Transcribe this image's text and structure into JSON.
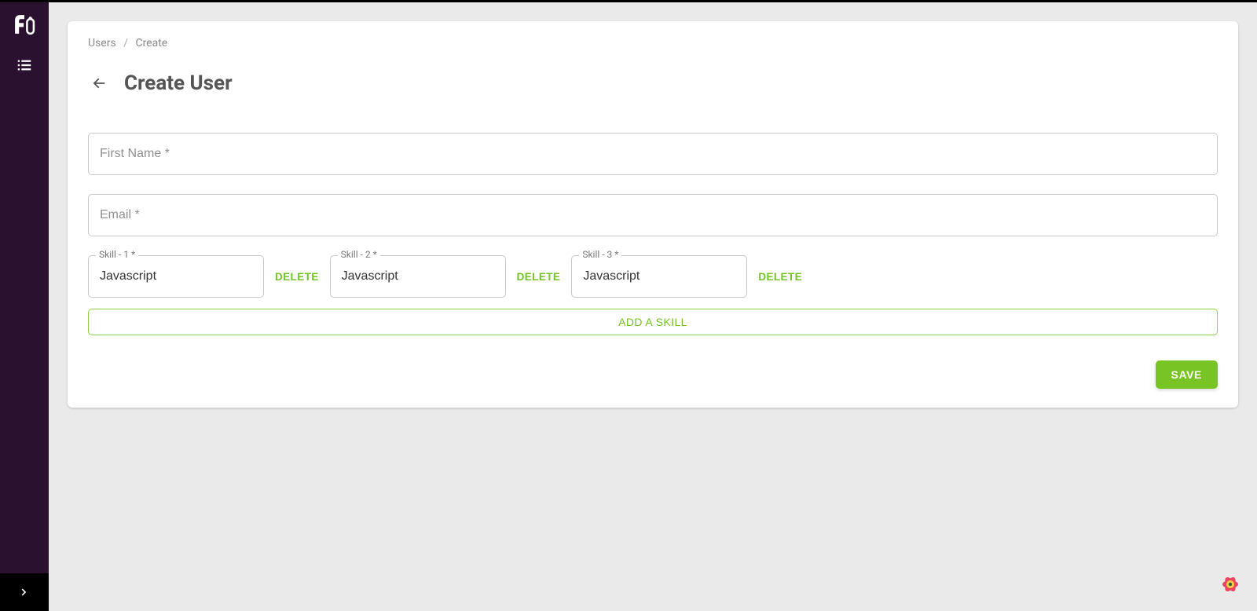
{
  "breadcrumb": {
    "parent": "Users",
    "current": "Create"
  },
  "page": {
    "title": "Create User"
  },
  "form": {
    "first_name_placeholder": "First Name *",
    "first_name_value": "",
    "email_placeholder": "Email *",
    "email_value": ""
  },
  "skills": [
    {
      "label": "Skill - 1 *",
      "value": "Javascript"
    },
    {
      "label": "Skill - 2 *",
      "value": "Javascript"
    },
    {
      "label": "Skill - 3 *",
      "value": "Javascript"
    }
  ],
  "buttons": {
    "delete": "DELETE",
    "add_skill": "ADD A SKILL",
    "save": "SAVE"
  },
  "colors": {
    "accent": "#78c425",
    "sidebar": "#2a1130"
  }
}
